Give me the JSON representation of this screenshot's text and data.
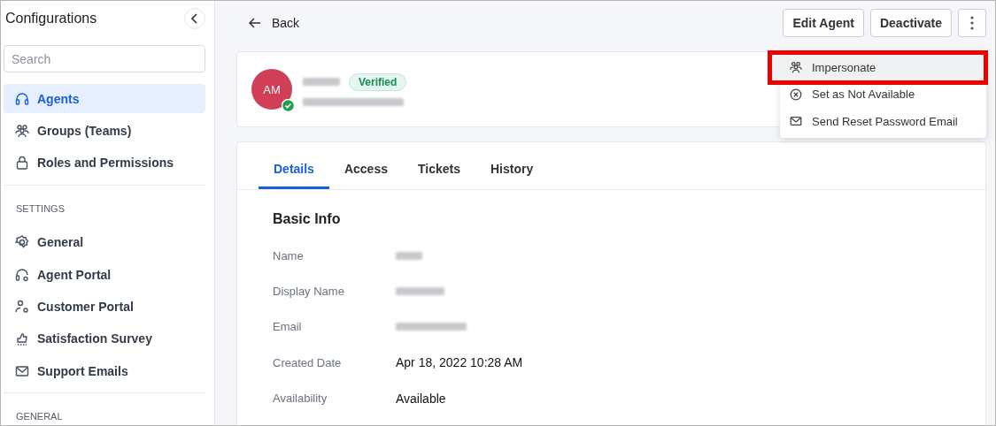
{
  "sidebar": {
    "title": "Configurations",
    "search": {
      "placeholder": "Search"
    },
    "items": [
      {
        "label": "Agents",
        "selected": true
      },
      {
        "label": "Groups (Teams)",
        "selected": false
      },
      {
        "label": "Roles and Permissions",
        "selected": false
      }
    ],
    "sections": [
      {
        "heading": "SETTINGS",
        "items": [
          {
            "label": "General",
            "selected": false
          },
          {
            "label": "Agent Portal",
            "selected": false
          },
          {
            "label": "Customer Portal",
            "selected": false
          },
          {
            "label": "Satisfaction Survey",
            "selected": false
          },
          {
            "label": "Support Emails",
            "selected": false
          }
        ]
      },
      {
        "heading": "GENERAL"
      }
    ]
  },
  "header": {
    "back": "Back",
    "buttons": [
      "Edit Agent",
      "Deactivate"
    ]
  },
  "menu": {
    "items": [
      {
        "label": "Impersonate",
        "highlighted": true
      },
      {
        "label": "Set as Not Available",
        "highlighted": false
      },
      {
        "label": "Send Reset Password Email",
        "highlighted": false
      }
    ]
  },
  "profile": {
    "initials": "AM",
    "badge": "Verified",
    "online": true
  },
  "tabs": [
    {
      "label": "Details",
      "selected": true
    },
    {
      "label": "Access",
      "selected": false
    },
    {
      "label": "Tickets",
      "selected": false
    },
    {
      "label": "History",
      "selected": false
    }
  ],
  "details": {
    "title": "Basic Info",
    "fields": [
      {
        "label": "Name",
        "redacted": true
      },
      {
        "label": "Display Name",
        "redacted": true
      },
      {
        "label": "Email",
        "redacted": true
      },
      {
        "label": "Created Date",
        "value": "Apr 18, 2022 10:28 AM"
      },
      {
        "label": "Availability",
        "value": "Available"
      }
    ]
  }
}
